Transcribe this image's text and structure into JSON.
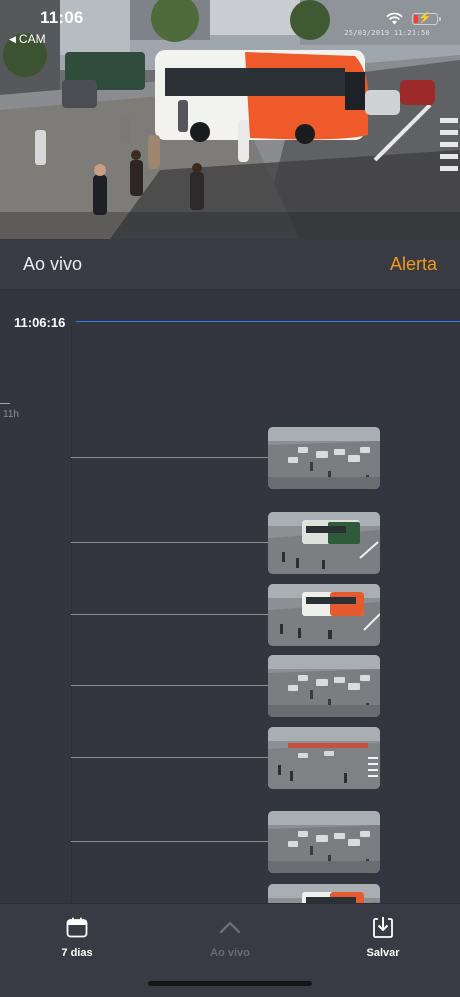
{
  "status_bar": {
    "time": "11:06",
    "back_app": "CAM",
    "back_icon": "back-triangle-icon",
    "wifi_icon": "wifi-icon",
    "battery_icon": "battery-charging-icon",
    "battery_level": 0.15
  },
  "camera": {
    "overlay_timestamp": "25/03/2019 11:21:50"
  },
  "header": {
    "live_title": "Ao vivo",
    "alert_label": "Alerta",
    "alert_color": "#f39a16"
  },
  "timeline": {
    "current_time": "11:06:16",
    "now_line_color": "#2f7de0",
    "hour_label": "11h",
    "events": [
      {
        "thumb": "intersection-cars"
      },
      {
        "thumb": "street-bus-green"
      },
      {
        "thumb": "street-bus-red"
      },
      {
        "thumb": "intersection-cars"
      },
      {
        "thumb": "street-crosswalk"
      },
      {
        "thumb": "intersection-cars"
      },
      {
        "thumb": "street-bus-red"
      }
    ]
  },
  "toolbar": {
    "days_label": "7 dias",
    "days_icon": "calendar-icon",
    "live_label": "Ao vivo",
    "live_icon": "chevron-up-icon",
    "save_label": "Salvar",
    "save_icon": "download-icon"
  }
}
